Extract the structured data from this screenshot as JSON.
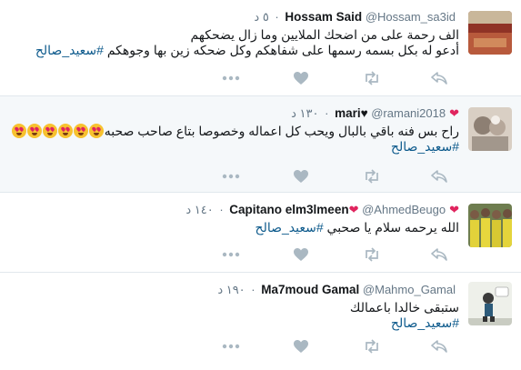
{
  "tweets": [
    {
      "name": "Hossam Said",
      "heart": "",
      "handle": "@Hossam_sa3id",
      "time": "٥ د",
      "lines": [
        "الف رحمة على من اضحك الملايين وما زال يضحكهم",
        "أدعو له بكل بسمه رسمها على شفاهكم وكل ضحكه زين بها وجوهكم"
      ],
      "hashtag": "#سعيد_صالح"
    },
    {
      "name": "mari",
      "heart": "♥",
      "heart2": "❤",
      "handle": "@ramani2018",
      "time": "١٣٠ د",
      "lines": [
        "راح بس فنه باقي بالبال ويحب كل اعماله وخصوصا بتاع صاحب صحبه"
      ],
      "hashtag": "#سعيد_صالح"
    },
    {
      "name": "Capitano elm3lmeen",
      "heart": "❤",
      "handle": "@AhmedBeugo",
      "time": "١٤٠ د",
      "lines": [
        "الله يرحمه سلام يا صحبي"
      ],
      "hashtag": "#سعيد_صالح"
    },
    {
      "name": "Ma7moud Gamal",
      "heart": "",
      "handle": "@Mahmo_Gamal",
      "time": "١٩٠ د",
      "lines": [
        "ستبقى خالدا باعمالك"
      ],
      "hashtag": "#سعيد_صالح"
    }
  ],
  "icons": {
    "more": "more-icon",
    "like": "heart-icon",
    "retweet": "retweet-icon",
    "reply": "reply-icon"
  },
  "colors": {
    "link": "#1b95e0",
    "heart": "#e0245e",
    "meta": "#657786",
    "action": "#aab8c2",
    "highlight_bg": "#f5f8fa"
  }
}
